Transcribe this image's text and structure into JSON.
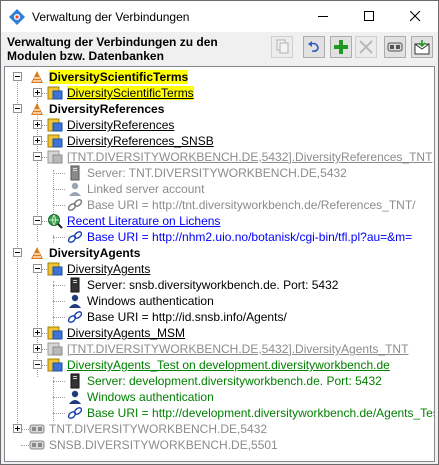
{
  "window": {
    "title": "Verwaltung der Verbindungen"
  },
  "header": {
    "text": "Verwaltung der Verbindungen zu den Modulen bzw. Datenbanken"
  },
  "toolbar": [
    {
      "name": "copy-button",
      "icon": "copy-icon",
      "enabled": false
    },
    {
      "name": "undo-button",
      "icon": "undo-icon",
      "enabled": true
    },
    {
      "name": "add-button",
      "icon": "plus-icon",
      "enabled": true
    },
    {
      "name": "remove-button",
      "icon": "remove-icon",
      "enabled": false
    },
    {
      "name": "connect-button",
      "icon": "link-icon",
      "enabled": true
    },
    {
      "name": "save-button",
      "icon": "save-icon",
      "enabled": true
    }
  ],
  "tree": {
    "dst": {
      "label": "DiversityScientificTerms",
      "items": [
        "DiversityScientificTerms"
      ]
    },
    "dr": {
      "label": "DiversityReferences",
      "items": [
        "DiversityReferences",
        "DiversityReferences_SNSB",
        "[TNT.DIVERSITYWORKBENCH.DE,5432].DiversityReferences_TNT"
      ],
      "tnt_children": [
        "Server: TNT.DIVERSITYWORKBENCH.DE,5432",
        "Linked server account",
        "Base URI = http://tnt.diversityworkbench.de/References_TNT/"
      ],
      "lit": "Recent Literature on Lichens",
      "lit_child": "Base URI = http://nhm2.uio.no/botanisk/cgi-bin/tfl.pl?au=&m="
    },
    "da": {
      "label": "DiversityAgents",
      "item1": "DiversityAgents",
      "item1_children": [
        "Server: snsb.diversityworkbench.de. Port: 5432",
        "Windows authentication",
        "Base URI = http://id.snsb.info/Agents/"
      ],
      "item2": "DiversityAgents_MSM",
      "item3": "[TNT.DIVERSITYWORKBENCH.DE,5432].DiversityAgents_TNT",
      "item4": "DiversityAgents_Test on development.diversityworkbench.de",
      "item4_children": [
        "Server: development.diversityworkbench.de. Port: 5432",
        "Windows authentication",
        "Base URI = http://development.diversityworkbench.de/Agents_Test/"
      ]
    },
    "servers": [
      "TNT.DIVERSITYWORKBENCH.DE,5432",
      "SNSB.DIVERSITYWORKBENCH.DE,5501"
    ]
  }
}
